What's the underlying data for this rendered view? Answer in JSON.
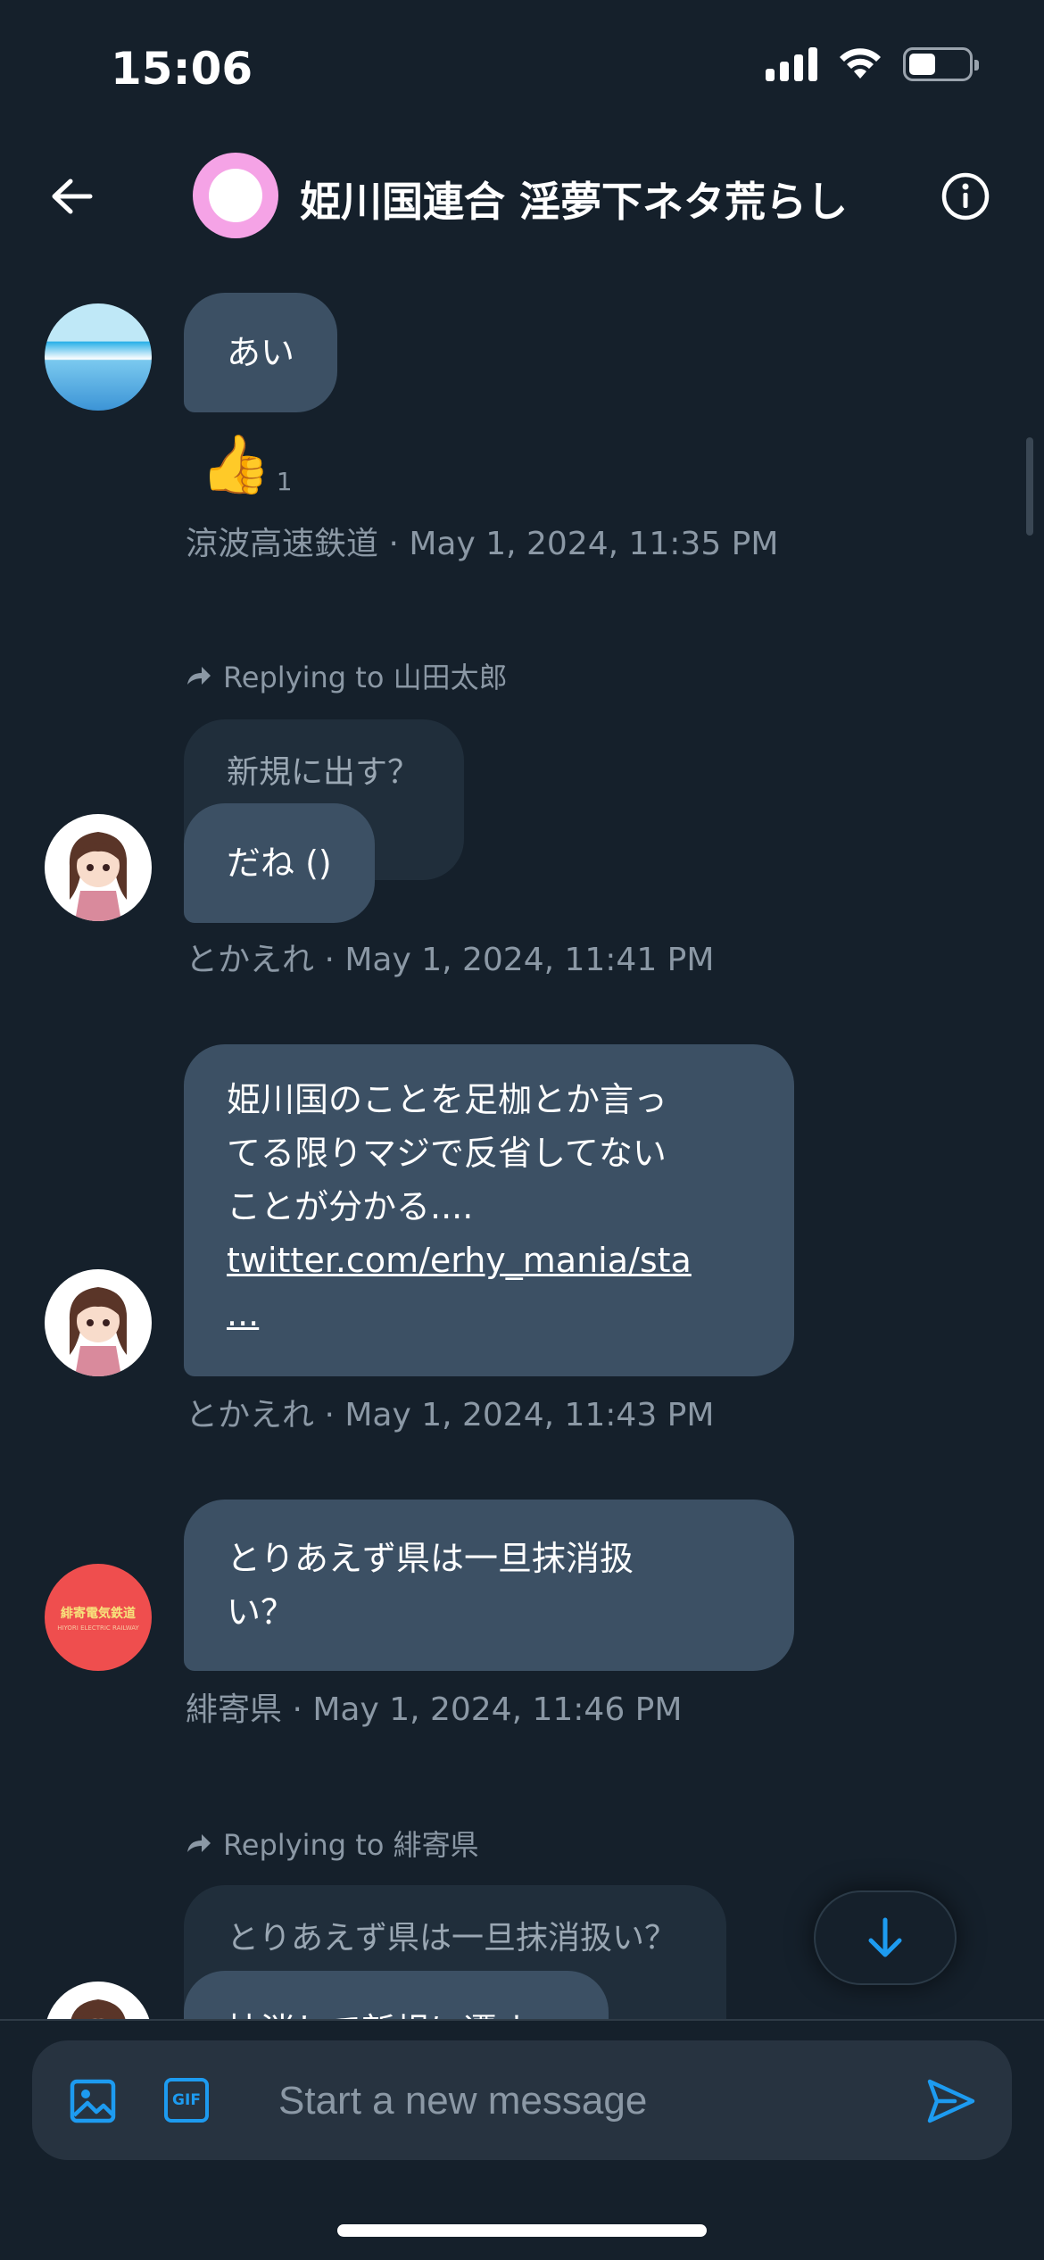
{
  "status_bar": {
    "time": "15:06",
    "battery_level": 0.45
  },
  "header": {
    "title": "姫川国連合 淫夢下ネタ荒らし",
    "back_icon": "arrow-left-icon",
    "info_icon": "info-icon"
  },
  "messages": [
    {
      "text": "あい",
      "reaction": {
        "emoji": "👍",
        "count": "1"
      },
      "meta": "涼波高速鉄道 · May 1, 2024, 11:35 PM"
    },
    {
      "reply_label": "Replying to 山田太郎",
      "quoted": "新規に出す？",
      "text": "だね ()",
      "meta": "とかえれ · May 1, 2024, 11:41 PM"
    },
    {
      "lines": [
        "姫川国のことを足枷とか言っ",
        "てる限りマジで反省してない",
        "ことが分かる...."
      ],
      "link": "twitter.com/erhy_mania/sta",
      "link_end": "...",
      "meta": "とかえれ · May 1, 2024, 11:43 PM"
    },
    {
      "lines": [
        "とりあえず県は一旦抹消扱",
        "い？"
      ],
      "meta": "緋寄県 · May 1, 2024, 11:46 PM",
      "avatar_logo": "緋寄電気鉄道",
      "avatar_logo_sub": "HIYORI ELECTRIC RAILWAY"
    },
    {
      "reply_label": "Replying to 緋寄県",
      "quoted": "とりあえず県は一旦抹消扱い？",
      "text": "抹消して新規に遷す"
    }
  ],
  "composer": {
    "placeholder": "Start a new message",
    "gif_label": "GIF",
    "image_icon": "image-icon",
    "send_icon": "send-icon"
  },
  "colors": {
    "background": "#15202b",
    "bubble": "#3c5064",
    "quoted_bubble": "#202e3b",
    "accent": "#1d9bf0",
    "meta_text": "#8b98a5"
  }
}
